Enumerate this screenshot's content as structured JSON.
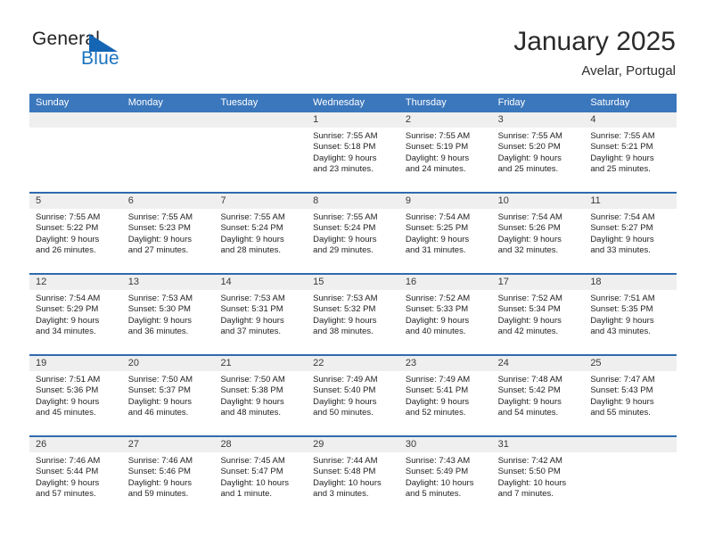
{
  "logo": {
    "word_one": "General",
    "word_two": "Blue",
    "icon": "triangle-icon"
  },
  "header": {
    "title": "January 2025",
    "location": "Avelar, Portugal"
  },
  "calendar": {
    "weekday_headers": [
      "Sunday",
      "Monday",
      "Tuesday",
      "Wednesday",
      "Thursday",
      "Friday",
      "Saturday"
    ],
    "colors": {
      "header_blue": "#3b77bc",
      "row_divider_blue": "#2f6cae",
      "day_band_gray": "#efefef",
      "logo_blue": "#1b73c0"
    },
    "weeks": [
      [
        {
          "day": "",
          "lines": []
        },
        {
          "day": "",
          "lines": []
        },
        {
          "day": "",
          "lines": []
        },
        {
          "day": "1",
          "lines": [
            "Sunrise: 7:55 AM",
            "Sunset: 5:18 PM",
            "Daylight: 9 hours",
            "and 23 minutes."
          ]
        },
        {
          "day": "2",
          "lines": [
            "Sunrise: 7:55 AM",
            "Sunset: 5:19 PM",
            "Daylight: 9 hours",
            "and 24 minutes."
          ]
        },
        {
          "day": "3",
          "lines": [
            "Sunrise: 7:55 AM",
            "Sunset: 5:20 PM",
            "Daylight: 9 hours",
            "and 25 minutes."
          ]
        },
        {
          "day": "4",
          "lines": [
            "Sunrise: 7:55 AM",
            "Sunset: 5:21 PM",
            "Daylight: 9 hours",
            "and 25 minutes."
          ]
        }
      ],
      [
        {
          "day": "5",
          "lines": [
            "Sunrise: 7:55 AM",
            "Sunset: 5:22 PM",
            "Daylight: 9 hours",
            "and 26 minutes."
          ]
        },
        {
          "day": "6",
          "lines": [
            "Sunrise: 7:55 AM",
            "Sunset: 5:23 PM",
            "Daylight: 9 hours",
            "and 27 minutes."
          ]
        },
        {
          "day": "7",
          "lines": [
            "Sunrise: 7:55 AM",
            "Sunset: 5:24 PM",
            "Daylight: 9 hours",
            "and 28 minutes."
          ]
        },
        {
          "day": "8",
          "lines": [
            "Sunrise: 7:55 AM",
            "Sunset: 5:24 PM",
            "Daylight: 9 hours",
            "and 29 minutes."
          ]
        },
        {
          "day": "9",
          "lines": [
            "Sunrise: 7:54 AM",
            "Sunset: 5:25 PM",
            "Daylight: 9 hours",
            "and 31 minutes."
          ]
        },
        {
          "day": "10",
          "lines": [
            "Sunrise: 7:54 AM",
            "Sunset: 5:26 PM",
            "Daylight: 9 hours",
            "and 32 minutes."
          ]
        },
        {
          "day": "11",
          "lines": [
            "Sunrise: 7:54 AM",
            "Sunset: 5:27 PM",
            "Daylight: 9 hours",
            "and 33 minutes."
          ]
        }
      ],
      [
        {
          "day": "12",
          "lines": [
            "Sunrise: 7:54 AM",
            "Sunset: 5:29 PM",
            "Daylight: 9 hours",
            "and 34 minutes."
          ]
        },
        {
          "day": "13",
          "lines": [
            "Sunrise: 7:53 AM",
            "Sunset: 5:30 PM",
            "Daylight: 9 hours",
            "and 36 minutes."
          ]
        },
        {
          "day": "14",
          "lines": [
            "Sunrise: 7:53 AM",
            "Sunset: 5:31 PM",
            "Daylight: 9 hours",
            "and 37 minutes."
          ]
        },
        {
          "day": "15",
          "lines": [
            "Sunrise: 7:53 AM",
            "Sunset: 5:32 PM",
            "Daylight: 9 hours",
            "and 38 minutes."
          ]
        },
        {
          "day": "16",
          "lines": [
            "Sunrise: 7:52 AM",
            "Sunset: 5:33 PM",
            "Daylight: 9 hours",
            "and 40 minutes."
          ]
        },
        {
          "day": "17",
          "lines": [
            "Sunrise: 7:52 AM",
            "Sunset: 5:34 PM",
            "Daylight: 9 hours",
            "and 42 minutes."
          ]
        },
        {
          "day": "18",
          "lines": [
            "Sunrise: 7:51 AM",
            "Sunset: 5:35 PM",
            "Daylight: 9 hours",
            "and 43 minutes."
          ]
        }
      ],
      [
        {
          "day": "19",
          "lines": [
            "Sunrise: 7:51 AM",
            "Sunset: 5:36 PM",
            "Daylight: 9 hours",
            "and 45 minutes."
          ]
        },
        {
          "day": "20",
          "lines": [
            "Sunrise: 7:50 AM",
            "Sunset: 5:37 PM",
            "Daylight: 9 hours",
            "and 46 minutes."
          ]
        },
        {
          "day": "21",
          "lines": [
            "Sunrise: 7:50 AM",
            "Sunset: 5:38 PM",
            "Daylight: 9 hours",
            "and 48 minutes."
          ]
        },
        {
          "day": "22",
          "lines": [
            "Sunrise: 7:49 AM",
            "Sunset: 5:40 PM",
            "Daylight: 9 hours",
            "and 50 minutes."
          ]
        },
        {
          "day": "23",
          "lines": [
            "Sunrise: 7:49 AM",
            "Sunset: 5:41 PM",
            "Daylight: 9 hours",
            "and 52 minutes."
          ]
        },
        {
          "day": "24",
          "lines": [
            "Sunrise: 7:48 AM",
            "Sunset: 5:42 PM",
            "Daylight: 9 hours",
            "and 54 minutes."
          ]
        },
        {
          "day": "25",
          "lines": [
            "Sunrise: 7:47 AM",
            "Sunset: 5:43 PM",
            "Daylight: 9 hours",
            "and 55 minutes."
          ]
        }
      ],
      [
        {
          "day": "26",
          "lines": [
            "Sunrise: 7:46 AM",
            "Sunset: 5:44 PM",
            "Daylight: 9 hours",
            "and 57 minutes."
          ]
        },
        {
          "day": "27",
          "lines": [
            "Sunrise: 7:46 AM",
            "Sunset: 5:46 PM",
            "Daylight: 9 hours",
            "and 59 minutes."
          ]
        },
        {
          "day": "28",
          "lines": [
            "Sunrise: 7:45 AM",
            "Sunset: 5:47 PM",
            "Daylight: 10 hours",
            "and 1 minute."
          ]
        },
        {
          "day": "29",
          "lines": [
            "Sunrise: 7:44 AM",
            "Sunset: 5:48 PM",
            "Daylight: 10 hours",
            "and 3 minutes."
          ]
        },
        {
          "day": "30",
          "lines": [
            "Sunrise: 7:43 AM",
            "Sunset: 5:49 PM",
            "Daylight: 10 hours",
            "and 5 minutes."
          ]
        },
        {
          "day": "31",
          "lines": [
            "Sunrise: 7:42 AM",
            "Sunset: 5:50 PM",
            "Daylight: 10 hours",
            "and 7 minutes."
          ]
        },
        {
          "day": "",
          "lines": []
        }
      ]
    ]
  }
}
